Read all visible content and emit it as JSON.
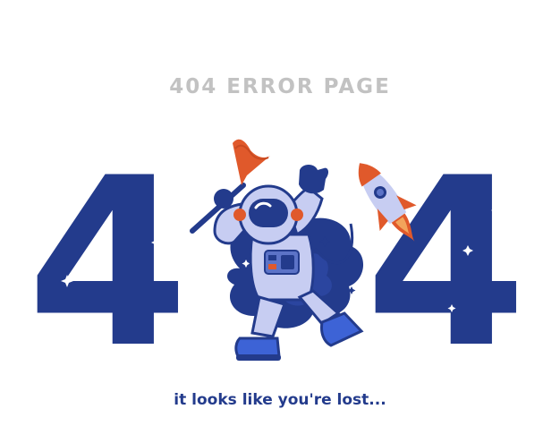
{
  "header": {
    "title": "404 ERROR PAGE"
  },
  "error_code": {
    "first_digit": "4",
    "second_digit": "4"
  },
  "message": {
    "text": "it looks like you're lost..."
  },
  "colors": {
    "primary": "#233b8c",
    "accent": "#e0592b",
    "suit": "#c7cdf2",
    "heading_gray": "#c2c2c2",
    "background": "#ffffff"
  },
  "illustration": {
    "subject": "astronaut-with-flag",
    "objects": [
      "astronaut",
      "flag",
      "rocket",
      "stars",
      "space-cloud"
    ]
  }
}
